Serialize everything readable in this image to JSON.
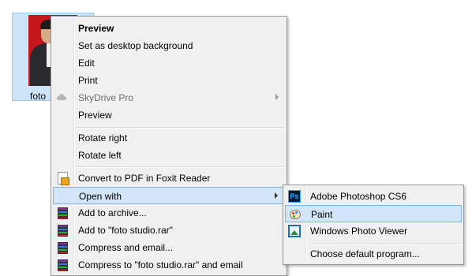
{
  "file": {
    "name": "foto studio",
    "label_visible": "foto"
  },
  "context_menu": {
    "items": [
      {
        "label": "Preview",
        "bold": true
      },
      {
        "label": "Set as desktop background"
      },
      {
        "label": "Edit"
      },
      {
        "label": "Print"
      },
      {
        "label": "SkyDrive Pro",
        "disabled": true,
        "icon": "cloud-icon",
        "has_submenu": true
      },
      {
        "label": "Preview"
      },
      {
        "label": "Rotate right"
      },
      {
        "label": "Rotate left"
      },
      {
        "label": "Convert to PDF in Foxit Reader",
        "icon": "pdf-icon"
      },
      {
        "label": "Open with",
        "highlighted": true,
        "has_submenu": true
      },
      {
        "label": "Add to archive...",
        "icon": "winrar-icon"
      },
      {
        "label": "Add to \"foto studio.rar\"",
        "icon": "winrar-icon"
      },
      {
        "label": "Compress and email...",
        "icon": "winrar-icon"
      },
      {
        "label": "Compress to \"foto studio.rar\" and email",
        "icon": "winrar-icon"
      }
    ]
  },
  "open_with_submenu": {
    "items": [
      {
        "label": "Adobe Photoshop CS6",
        "icon": "photoshop-icon",
        "icon_text": "Ps"
      },
      {
        "label": "Paint",
        "icon": "paint-icon",
        "highlighted": true
      },
      {
        "label": "Windows Photo Viewer",
        "icon": "photo-viewer-icon"
      },
      {
        "label": "Choose default program..."
      }
    ]
  },
  "colors": {
    "highlight_bg": "#d3e5f8",
    "highlight_border": "#7fb5e5",
    "selection_bg": "#cce4f7",
    "menu_bg": "#f0f0f0"
  }
}
